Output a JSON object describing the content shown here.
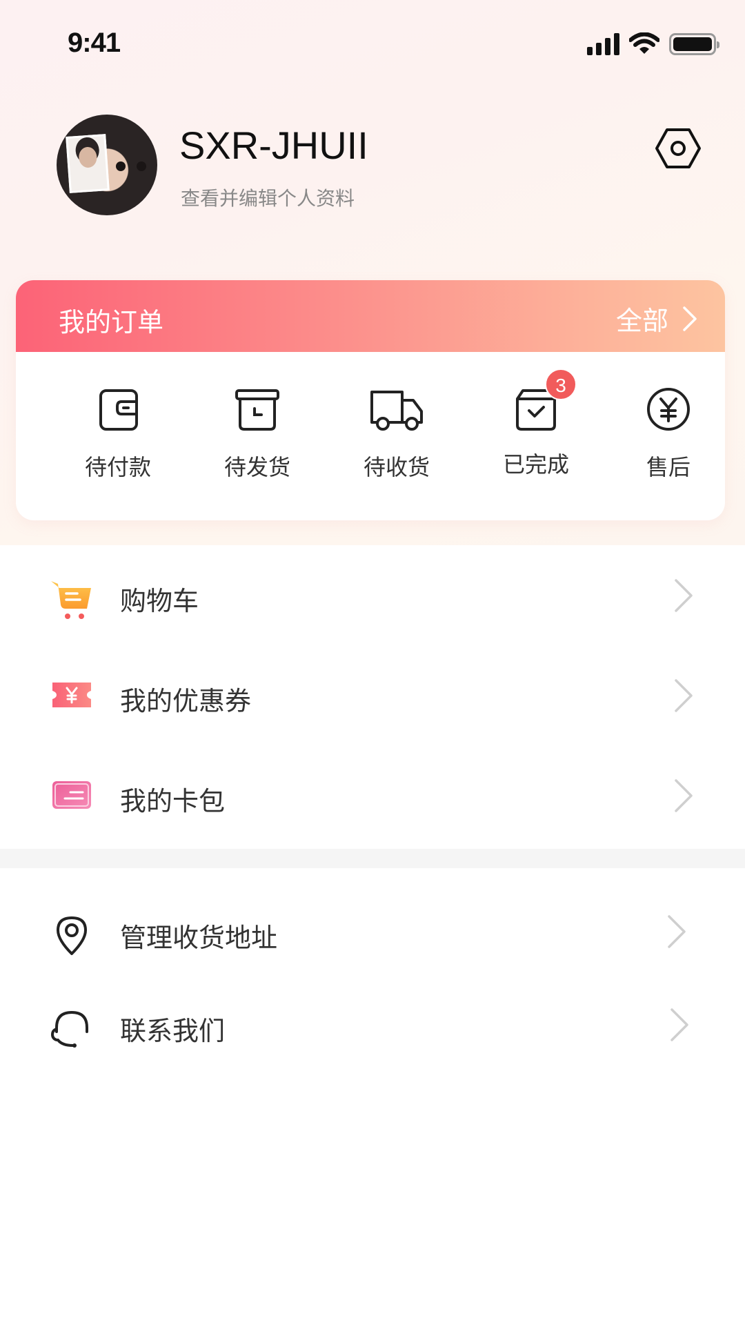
{
  "status_bar": {
    "time": "9:41"
  },
  "profile": {
    "name": "SXR-JHUII",
    "subtitle": "查看并编辑个人资料"
  },
  "orders": {
    "title": "我的订单",
    "all_label": "全部",
    "items": [
      {
        "label": "待付款",
        "icon": "wallet-icon"
      },
      {
        "label": "待发货",
        "icon": "box-icon"
      },
      {
        "label": "待收货",
        "icon": "truck-icon"
      },
      {
        "label": "已完成",
        "icon": "completed-box-icon",
        "badge": "3"
      },
      {
        "label": "售后",
        "icon": "yen-circle-icon"
      }
    ]
  },
  "menu_primary": [
    {
      "label": "购物车",
      "icon": "cart-icon"
    },
    {
      "label": "我的优惠券",
      "icon": "coupon-icon"
    },
    {
      "label": "我的卡包",
      "icon": "card-icon"
    }
  ],
  "menu_secondary": [
    {
      "label": "管理收货地址",
      "icon": "location-pin-icon"
    },
    {
      "label": "联系我们",
      "icon": "headset-icon"
    }
  ],
  "colors": {
    "accent_gradient_start": "#fc6377",
    "accent_gradient_end": "#fdc4a0",
    "badge": "#f15b5b"
  }
}
